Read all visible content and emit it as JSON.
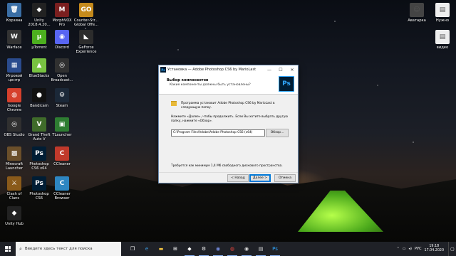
{
  "desktop_icons": [
    {
      "label": "Корзина",
      "glyph": "🗑",
      "color": "#3a6ea5",
      "icon": "recycle-bin-icon"
    },
    {
      "label": "Unity 2018.4.20...",
      "glyph": "◆",
      "color": "#222",
      "icon": "unity-icon"
    },
    {
      "label": "MorphVOX Pro",
      "glyph": "M",
      "color": "#7a1f1f",
      "icon": "morphvox-icon"
    },
    {
      "label": "Counter-Str... Global Offe...",
      "glyph": "GO",
      "color": "#c48a1c",
      "icon": "csgo-icon"
    },
    {
      "label": "Warface",
      "glyph": "W",
      "color": "#333",
      "icon": "warface-icon"
    },
    {
      "label": "μTorrent",
      "glyph": "μ",
      "color": "#4caf1f",
      "icon": "utorrent-icon"
    },
    {
      "label": "Discord",
      "glyph": "◉",
      "color": "#5865f2",
      "icon": "discord-icon"
    },
    {
      "label": "GeForce Experience",
      "glyph": "◣",
      "color": "#2c2c2c",
      "icon": "geforce-icon"
    },
    {
      "label": "Игровой центр",
      "glyph": "▦",
      "color": "#2a4b8d",
      "icon": "game-center-icon"
    },
    {
      "label": "BlueStacks",
      "glyph": "▲",
      "color": "#78c341",
      "icon": "bluestacks-icon"
    },
    {
      "label": "Open Broadcast...",
      "glyph": "◎",
      "color": "#303030",
      "icon": "obs-icon"
    },
    {
      "label": "Google Chrome",
      "glyph": "◍",
      "color": "#d6402c",
      "icon": "chrome-icon"
    },
    {
      "label": "Bandicam",
      "glyph": "●",
      "color": "#111",
      "icon": "bandicam-icon"
    },
    {
      "label": "Steam",
      "glyph": "⚙",
      "color": "#1b2838",
      "icon": "steam-icon"
    },
    {
      "label": "OBS Studio",
      "glyph": "◎",
      "color": "#303030",
      "icon": "obs-studio-icon"
    },
    {
      "label": "Grand Theft Auto V",
      "glyph": "V",
      "color": "#3f6b2a",
      "icon": "gta-icon"
    },
    {
      "label": "TLauncher",
      "glyph": "▣",
      "color": "#2e7d32",
      "icon": "tlauncher-icon"
    },
    {
      "label": "Minecraft Launcher",
      "glyph": "▩",
      "color": "#6b4f2a",
      "icon": "minecraft-icon"
    },
    {
      "label": "Photoshop CS6 x64",
      "glyph": "Ps",
      "color": "#001d34",
      "icon": "photoshop-icon"
    },
    {
      "label": "CCleaner",
      "glyph": "C",
      "color": "#c0392b",
      "icon": "ccleaner-icon"
    },
    {
      "label": "Clash of Clans",
      "glyph": "⚔",
      "color": "#8a5a1a",
      "icon": "clash-icon"
    },
    {
      "label": "Photoshop CS6",
      "glyph": "Ps",
      "color": "#001d34",
      "icon": "photoshop-icon"
    },
    {
      "label": "CCleaner Browser",
      "glyph": "C",
      "color": "#2e86c1",
      "icon": "ccleaner-browser-icon"
    },
    {
      "label": "Unity Hub",
      "glyph": "◆",
      "color": "#222",
      "icon": "unity-hub-icon"
    }
  ],
  "right_icons": [
    {
      "label": "Аватарка",
      "glyph": "☺",
      "color": "#444",
      "icon": "avatar-file-icon"
    },
    {
      "label": "Нужно",
      "glyph": "▤",
      "color": "#eee",
      "icon": "file-icon"
    },
    {
      "label": "видео",
      "glyph": "▤",
      "color": "#eee",
      "icon": "file-icon"
    }
  ],
  "window": {
    "title": "Установка — Adobe Photoshop CS6 by MarioLast",
    "header_title": "Выбор компонентов",
    "header_subtitle": "Какие компоненты должны быть установлены?",
    "logo": "Ps",
    "para1": "Программа установит Adobe Photoshop CS6 by MarioLast в следующую папку.",
    "para2": "Нажмите «Далее», чтобы продолжить. Если Вы хотите выбрать другую папку, нажмите «Обзор».",
    "path": "C:\\Program Files\\Adobe\\Adobe Photoshop CS6 (x64)",
    "browse": "Обзор...",
    "space": "Требуется как минимум 1,4 Мб свободного дискового пространства.",
    "back": "< Назад",
    "next": "Далее >",
    "cancel": "Отмена"
  },
  "taskbar": {
    "search_placeholder": "Введите здесь текст для поиска",
    "lang": "РУС",
    "time": "19:18",
    "date": "17.04.2020",
    "apps": [
      {
        "glyph": "❒",
        "icon": "task-view-icon",
        "color": "#fff"
      },
      {
        "glyph": "e",
        "icon": "edge-icon",
        "color": "#3b9ae1"
      },
      {
        "glyph": "▬",
        "icon": "file-explorer-icon",
        "color": "#f4c542"
      },
      {
        "glyph": "⊞",
        "icon": "store-icon",
        "color": "#fff"
      },
      {
        "glyph": "◆",
        "icon": "unity-taskbar-icon",
        "color": "#fff"
      },
      {
        "glyph": "⚙",
        "icon": "steam-taskbar-icon",
        "color": "#fff"
      },
      {
        "glyph": "◉",
        "icon": "discord-taskbar-icon",
        "color": "#7289da"
      },
      {
        "glyph": "◍",
        "icon": "chrome-taskbar-icon",
        "color": "#e8453c"
      },
      {
        "glyph": "◉",
        "icon": "obs-taskbar-icon",
        "color": "#ddd"
      },
      {
        "glyph": "▤",
        "icon": "notes-taskbar-icon",
        "color": "#ddd"
      },
      {
        "glyph": "Ps",
        "icon": "photoshop-taskbar-icon",
        "color": "#31a8ff"
      }
    ]
  }
}
